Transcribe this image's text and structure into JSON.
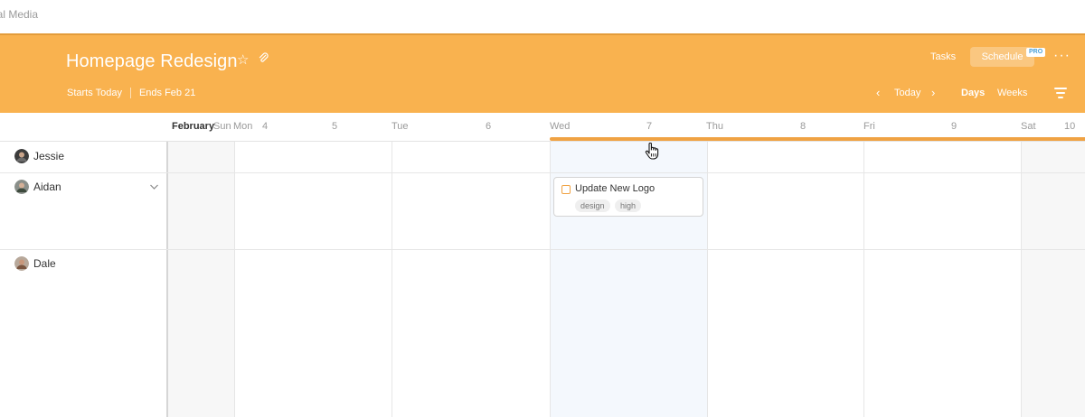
{
  "topbar": {
    "breadcrumb": "ial Media"
  },
  "header": {
    "title": "Homepage Redesign",
    "starts": "Starts Today",
    "ends": "Ends Feb 21",
    "tasks_tab": "Tasks",
    "schedule_tab": "Schedule",
    "pro_badge": "PRO",
    "more": "···",
    "today": "Today",
    "days": "Days",
    "weeks": "Weeks",
    "accent_color": "#f9b24f"
  },
  "dayheader": {
    "month": "February",
    "labels": [
      "Sun",
      "Mon",
      "4",
      "5",
      "Tue",
      "6",
      "Wed",
      "7",
      "Thu",
      "8",
      "Fri",
      "9",
      "Sat",
      "10"
    ]
  },
  "people": [
    {
      "name": "Jessie"
    },
    {
      "name": "Aidan"
    },
    {
      "name": "Dale"
    }
  ],
  "task": {
    "title": "Update New Logo",
    "tags": [
      "design",
      "high"
    ]
  }
}
